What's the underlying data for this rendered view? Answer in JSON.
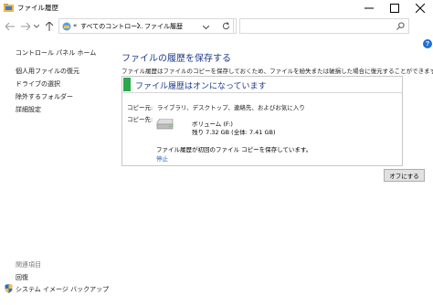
{
  "window": {
    "title": "ファイル履歴"
  },
  "address_bar": {
    "overflow": "«",
    "crumb1": "すべてのコントロー...",
    "crumb2": "ファイル履歴"
  },
  "search": {
    "placeholder": ""
  },
  "help": {
    "label": "?"
  },
  "sidebar": {
    "home": "コントロール パネル ホーム",
    "items": [
      {
        "label": "個人用ファイルの復元"
      },
      {
        "label": "ドライブの選択"
      },
      {
        "label": "除外するフォルダー"
      },
      {
        "label": "詳細設定"
      }
    ],
    "see_also_heading": "関連項目",
    "see_also": [
      {
        "label": "回復"
      },
      {
        "label": "システム イメージ バックアップ"
      }
    ]
  },
  "main": {
    "title": "ファイルの履歴を保存する",
    "description": "ファイル履歴はファイルのコピーを保存しておくため、ファイルを紛失または破損した場合に復元することができます。",
    "status": "ファイル履歴はオンになっています",
    "copy_from_label": "コピー元:",
    "copy_from_value": "ライブラリ、デスクトップ、連絡先、およびお気に入り",
    "copy_to_label": "コピー先:",
    "drive_name": "ボリューム (F:)",
    "drive_space": "残り 7.32 GB (全体: 7.41 GB)",
    "message": "ファイル履歴が初回のファイル コピーを保存しています。",
    "stop_link": "停止",
    "off_button": "オフにする",
    "status_color": "#2aa84a"
  }
}
